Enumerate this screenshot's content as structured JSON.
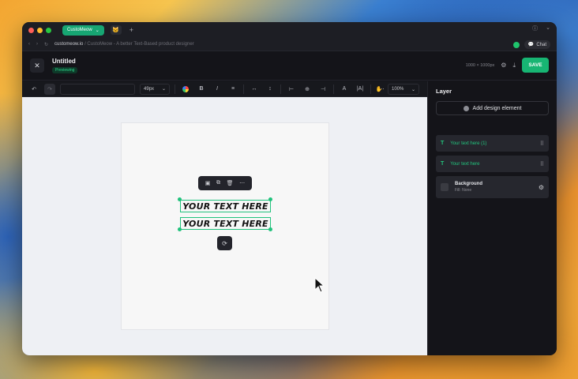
{
  "browser": {
    "tab_label": "CustoMeow",
    "url_host": "customeow.io",
    "url_rest": "/ CustoMeow - A better Text-Based product designer",
    "chat_label": "Chat"
  },
  "header": {
    "title": "Untitled",
    "badge": "Previewing",
    "dimensions": "1000 × 1000px",
    "save_label": "SAVE"
  },
  "toolbar": {
    "font_size": "49px",
    "bold": "B",
    "italic": "I",
    "zoom": "100%"
  },
  "canvas": {
    "text1": "YOUR TEXT HERE",
    "text2": "YOUR TEXT HERE"
  },
  "panel": {
    "title": "Layer",
    "add_label": "Add design element",
    "layers": [
      {
        "label": "Your text here (1)"
      },
      {
        "label": "Your text here"
      }
    ],
    "background": {
      "name": "Background",
      "fill": "Fill: None"
    }
  },
  "colors": {
    "accent": "#17b573",
    "panel_bg": "#141419",
    "canvas_bg": "#eef0f4"
  }
}
